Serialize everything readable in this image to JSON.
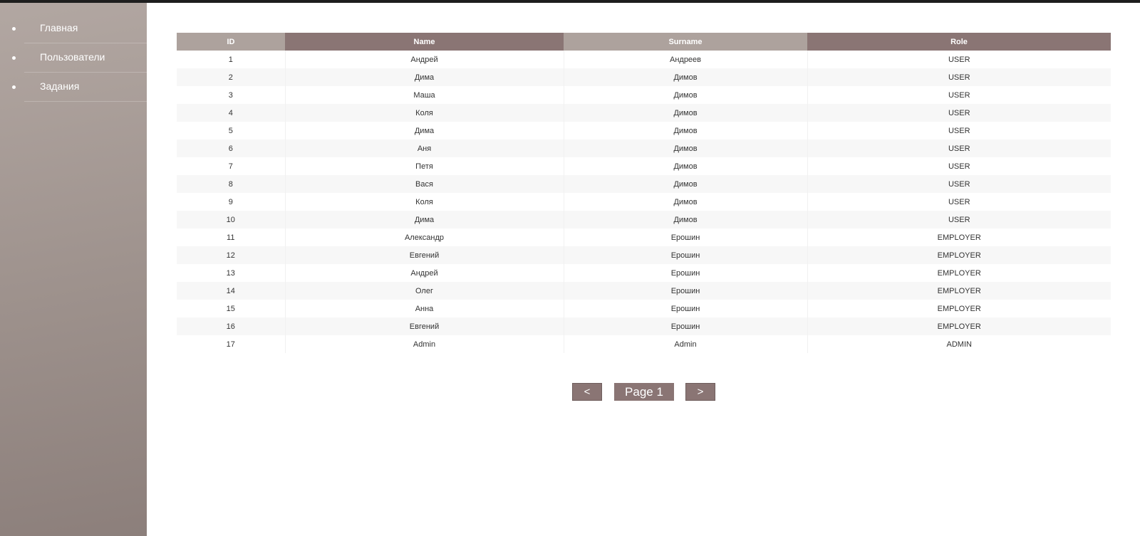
{
  "sidebar": {
    "items": [
      {
        "label": "Главная"
      },
      {
        "label": "Пользователи"
      },
      {
        "label": "Задания"
      }
    ]
  },
  "table": {
    "headers": {
      "id": "ID",
      "name": "Name",
      "surname": "Surname",
      "role": "Role"
    },
    "rows": [
      {
        "id": "1",
        "name": "Андрей",
        "surname": "Андреев",
        "role": "USER"
      },
      {
        "id": "2",
        "name": "Дима",
        "surname": "Димов",
        "role": "USER"
      },
      {
        "id": "3",
        "name": "Маша",
        "surname": "Димов",
        "role": "USER"
      },
      {
        "id": "4",
        "name": "Коля",
        "surname": "Димов",
        "role": "USER"
      },
      {
        "id": "5",
        "name": "Дима",
        "surname": "Димов",
        "role": "USER"
      },
      {
        "id": "6",
        "name": "Аня",
        "surname": "Димов",
        "role": "USER"
      },
      {
        "id": "7",
        "name": "Петя",
        "surname": "Димов",
        "role": "USER"
      },
      {
        "id": "8",
        "name": "Вася",
        "surname": "Димов",
        "role": "USER"
      },
      {
        "id": "9",
        "name": "Коля",
        "surname": "Димов",
        "role": "USER"
      },
      {
        "id": "10",
        "name": "Дима",
        "surname": "Димов",
        "role": "USER"
      },
      {
        "id": "11",
        "name": "Александр",
        "surname": "Ерошин",
        "role": "EMPLOYER"
      },
      {
        "id": "12",
        "name": "Евгений",
        "surname": "Ерошин",
        "role": "EMPLOYER"
      },
      {
        "id": "13",
        "name": "Андрей",
        "surname": "Ерошин",
        "role": "EMPLOYER"
      },
      {
        "id": "14",
        "name": "Олег",
        "surname": "Ерошин",
        "role": "EMPLOYER"
      },
      {
        "id": "15",
        "name": "Анна",
        "surname": "Ерошин",
        "role": "EMPLOYER"
      },
      {
        "id": "16",
        "name": "Евгений",
        "surname": "Ерошин",
        "role": "EMPLOYER"
      },
      {
        "id": "17",
        "name": "Admin",
        "surname": "Admin",
        "role": "ADMIN"
      }
    ]
  },
  "pager": {
    "prev_label": "<",
    "page_label": "Page 1",
    "next_label": ">"
  },
  "colors": {
    "header_dark": "#8a7574",
    "header_light": "#ada29d",
    "sidebar": "#9d918c"
  }
}
